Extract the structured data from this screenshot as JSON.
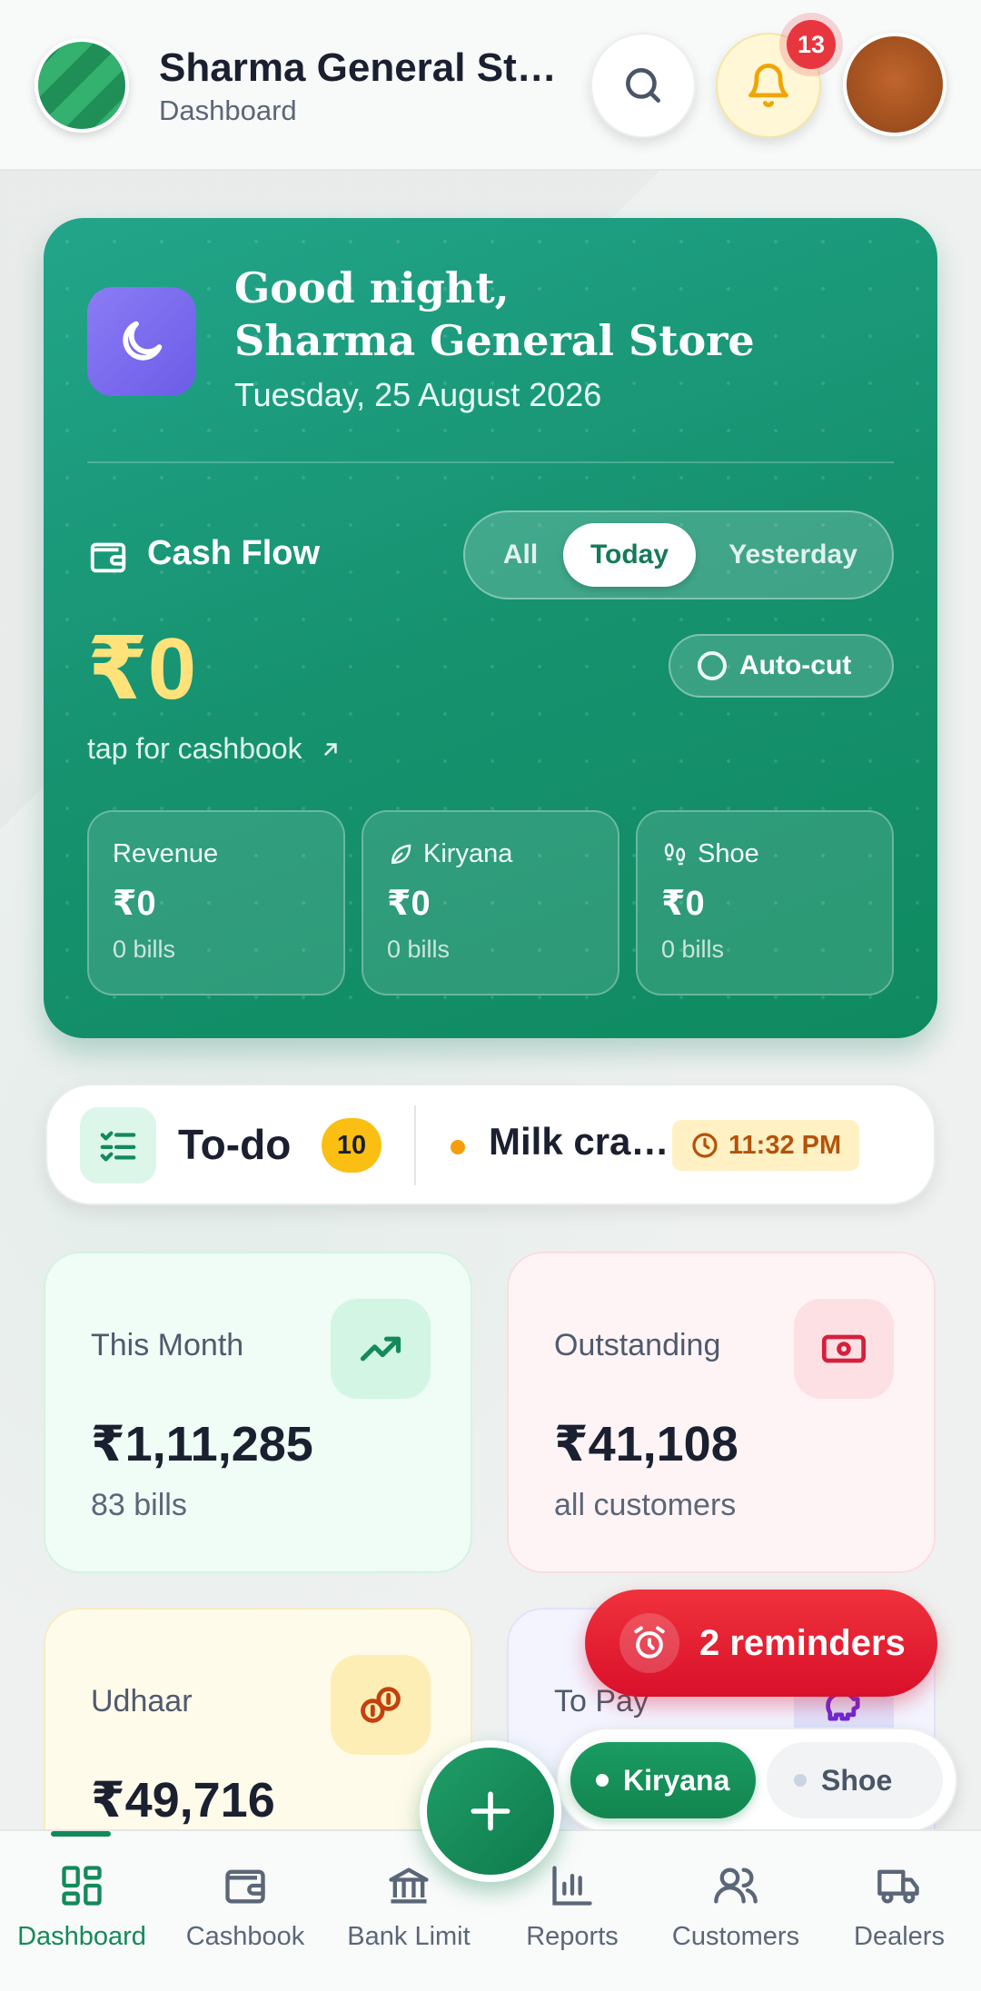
{
  "header": {
    "store_name": "Sharma General Store",
    "subtitle": "Dashboard",
    "notification_count": "13"
  },
  "hero": {
    "greeting_line1": "Good night,",
    "greeting_line2": "Sharma General Store",
    "date": "Tuesday, 25 August 2026",
    "cashflow_title": "Cash Flow",
    "filters": [
      "All",
      "Today",
      "Yesterday"
    ],
    "selected_filter": "Today",
    "cash_amount": "₹0",
    "autocut_label": "Auto-cut",
    "tap_label": "tap for cashbook",
    "minis": [
      {
        "label": "Revenue",
        "amount": "₹0",
        "bills": "0 bills"
      },
      {
        "label": "Kiryana",
        "amount": "₹0",
        "bills": "0 bills"
      },
      {
        "label": "Shoe",
        "amount": "₹0",
        "bills": "0 bills"
      }
    ]
  },
  "todo": {
    "title": "To-do",
    "count": "10",
    "task": "Milk crate return",
    "time": "11:32 PM"
  },
  "stats": [
    {
      "label": "This Month",
      "value": "₹1,11,285",
      "sub": "83 bills"
    },
    {
      "label": "Outstanding",
      "value": "₹41,108",
      "sub": "all customers"
    },
    {
      "label": "Udhaar",
      "value": "₹49,716",
      "sub": ""
    },
    {
      "label": "To Pay",
      "value": "",
      "sub": ""
    }
  ],
  "reminders_label": "2 reminders",
  "store_switch": {
    "active": "Kiryana",
    "inactive": "Shoe"
  },
  "nav": [
    {
      "label": "Dashboard",
      "icon": "dashboard-icon"
    },
    {
      "label": "Cashbook",
      "icon": "wallet-icon"
    },
    {
      "label": "Bank Limit",
      "icon": "bank-icon"
    },
    {
      "label": "Reports",
      "icon": "bar-chart-icon"
    },
    {
      "label": "Customers",
      "icon": "users-icon"
    },
    {
      "label": "Dealers",
      "icon": "truck-icon"
    }
  ],
  "colors": {
    "primary": "#138a5a",
    "accent_yellow": "#ffe27a",
    "danger": "#e8363f"
  }
}
